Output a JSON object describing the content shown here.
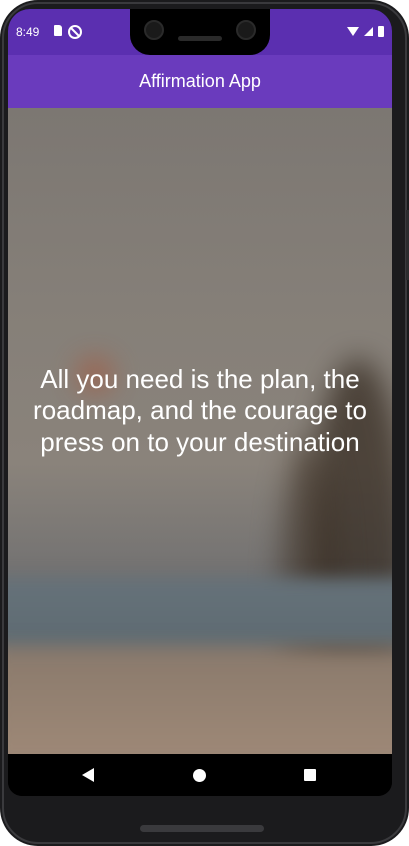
{
  "status_bar": {
    "time": "8:49",
    "left_icons": [
      "sd-card-icon",
      "do-not-disturb-icon"
    ],
    "right_icons": [
      "wifi-icon",
      "signal-icon",
      "battery-icon"
    ]
  },
  "app_bar": {
    "title": "Affirmation App"
  },
  "content": {
    "quote": "All you need is the plan, the roadmap, and the courage to press on to your destination"
  },
  "nav_bar": {
    "icons": [
      "back-icon",
      "home-icon",
      "recents-icon"
    ]
  },
  "colors": {
    "status_bar": "#5b2fb0",
    "app_bar": "#6a3bbd",
    "text": "#ffffff"
  }
}
